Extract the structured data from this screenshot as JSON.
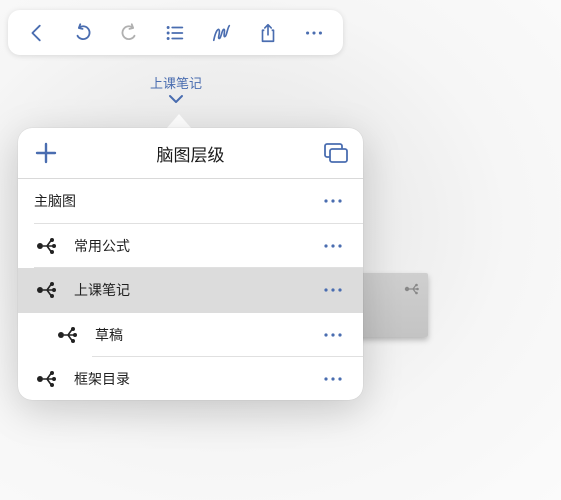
{
  "toolbar": {
    "icons": [
      "back-chevron-icon",
      "undo-icon",
      "redo-icon",
      "outline-list-icon",
      "scribble-pen-icon",
      "share-icon",
      "more-icon"
    ]
  },
  "document": {
    "title": "上课笔记"
  },
  "popover": {
    "title": "脑图层级",
    "rows": [
      {
        "label": "主脑图",
        "level": 0,
        "selected": false
      },
      {
        "label": "常用公式",
        "level": 1,
        "selected": false
      },
      {
        "label": "上课笔记",
        "level": 1,
        "selected": true
      },
      {
        "label": "草稿",
        "level": 2,
        "selected": false
      },
      {
        "label": "框架目录",
        "level": 1,
        "selected": false
      }
    ]
  },
  "colors": {
    "accent": "#4a6db0",
    "selected_row": "#dcdcdc",
    "background": "#ededed"
  }
}
